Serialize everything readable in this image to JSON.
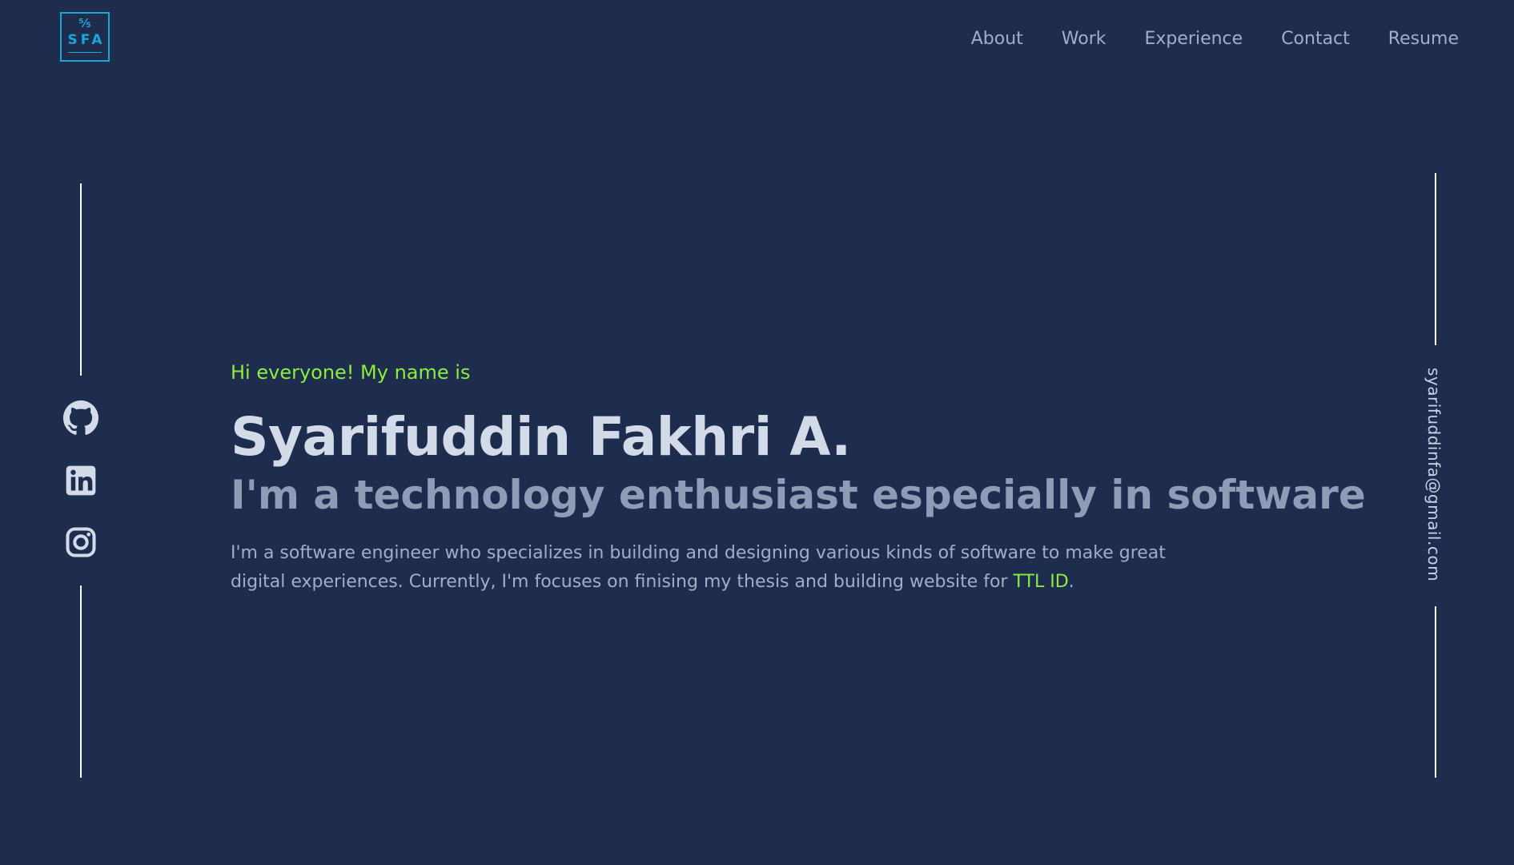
{
  "logo": {
    "mark": "⁵⁄₅",
    "text": "SFA"
  },
  "nav": {
    "items": [
      "About",
      "Work",
      "Experience",
      "Contact",
      "Resume"
    ]
  },
  "social": {
    "icons": [
      "github-icon",
      "linkedin-icon",
      "instagram-icon"
    ]
  },
  "email": "syarifuddinfa@gmail.com",
  "hero": {
    "greeting": "Hi everyone! My name is",
    "name": "Syarifuddin Fakhri A.",
    "tagline": "I'm a technology enthusiast especially in software",
    "bio_text": "I'm a software engineer who specializes in building and designing various kinds of software to make great digital experiences. Currently, I'm focuses on finising my thesis and building website for ",
    "bio_link": "TTL ID",
    "bio_end": "."
  },
  "colors": {
    "background": "#1e2c4e",
    "accent_green": "#8ced3f",
    "logo_blue": "#1ba6d6",
    "heading": "#d4dbe8",
    "muted": "#8d9db6"
  }
}
